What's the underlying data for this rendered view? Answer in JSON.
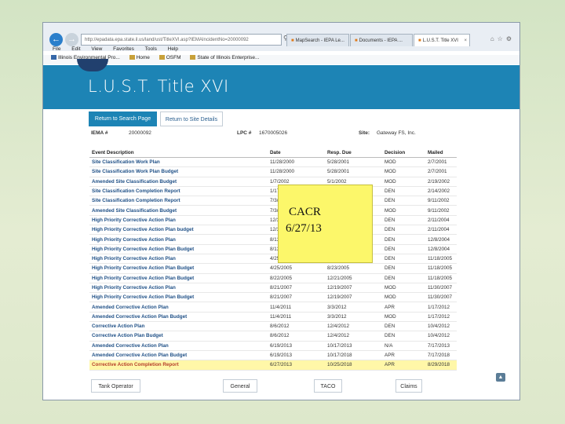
{
  "browser": {
    "url": "http://epadata.epa.state.il.us/land/ust/TitleXVI.asp?IEMAIncidentNo=20000092",
    "tabs": [
      {
        "label": "MapSearch - IEPA Le..."
      },
      {
        "label": "Documents - IEPA ..."
      },
      {
        "label": "L.U.S.T. Title XVI"
      }
    ],
    "menu": [
      "File",
      "Edit",
      "View",
      "Favorites",
      "Tools",
      "Help"
    ],
    "favorites": [
      "Illinois Environmental Pro...",
      "Home",
      "OSFM",
      "State of Illinois Enterprise..."
    ]
  },
  "page": {
    "title": "L.U.S.T. Title XVI",
    "buttons": {
      "return_search": "Return to Search Page",
      "return_site": "Return to Site Details"
    },
    "info": {
      "iema_label": "IEMA #",
      "iema_value": "20000092",
      "lpc_label": "LPC #",
      "lpc_value": "1670005026",
      "site_label": "Site:",
      "site_value": "Gateway FS, Inc."
    },
    "table": {
      "headers": [
        "Event Description",
        "Date",
        "Resp. Due",
        "Decision",
        "Mailed"
      ],
      "rows": [
        [
          "Site Classification Work Plan",
          "11/28/2000",
          "5/28/2001",
          "MOD",
          "2/7/2001"
        ],
        [
          "Site Classification Work Plan Budget",
          "11/28/2000",
          "5/28/2001",
          "MOD",
          "2/7/2001"
        ],
        [
          "Amended Site Classification Budget",
          "1/7/2002",
          "5/1/2002",
          "MOD",
          "2/19/2002"
        ],
        [
          "Site Classification Completion Report",
          "1/17/2002",
          "",
          "DEN",
          "2/14/2002"
        ],
        [
          "Site Classification Completion Report",
          "7/3/2002",
          "",
          "DEN",
          "9/11/2002"
        ],
        [
          "Amended Site Classification Budget",
          "7/3/2002",
          "",
          "MOD",
          "9/11/2002"
        ],
        [
          "High Priority Corrective Action Plan",
          "12/30/2003",
          "",
          "DEN",
          "2/11/2004"
        ],
        [
          "High Priority Corrective Action Plan budget",
          "12/30/2003",
          "",
          "DEN",
          "2/11/2004"
        ],
        [
          "High Priority Corrective Action Plan",
          "8/13/2004",
          "",
          "DEN",
          "12/8/2004"
        ],
        [
          "High Priority Corrective Action Plan Budget",
          "8/13/2004",
          "",
          "DEN",
          "12/8/2004"
        ],
        [
          "High Priority Corrective Action Plan",
          "4/25/2005",
          "",
          "DEN",
          "11/18/2005"
        ],
        [
          "High Priority Corrective Action Plan Budget",
          "4/25/2005",
          "8/23/2005",
          "DEN",
          "11/18/2005"
        ],
        [
          "High Priority Corrective Action Plan Budget",
          "8/22/2005",
          "12/21/2005",
          "DEN",
          "11/18/2005"
        ],
        [
          "High Priority Corrective Action Plan",
          "8/21/2007",
          "12/19/2007",
          "MOD",
          "11/30/2007"
        ],
        [
          "High Priority Corrective Action Plan Budget",
          "8/21/2007",
          "12/19/2007",
          "MOD",
          "11/30/2007"
        ],
        [
          "Amended Corrective Action Plan",
          "11/4/2011",
          "3/3/2012",
          "APR",
          "1/17/2012"
        ],
        [
          "Amended Corrective Action Plan Budget",
          "11/4/2011",
          "3/3/2012",
          "MOD",
          "1/17/2012"
        ],
        [
          "Corrective Action Plan",
          "8/6/2012",
          "12/4/2012",
          "DEN",
          "10/4/2012"
        ],
        [
          "Corrective Action Plan Budget",
          "8/6/2012",
          "12/4/2012",
          "DEN",
          "10/4/2012"
        ],
        [
          "Amended Corrective Action Plan",
          "6/19/2013",
          "10/17/2013",
          "N/A",
          "7/17/2013"
        ],
        [
          "Amended Corrective Action Plan Budget",
          "6/19/2013",
          "10/17/2018",
          "APR",
          "7/17/2018"
        ],
        [
          "Corrective Action Completion Report",
          "6/27/2013",
          "10/25/2018",
          "APR",
          "8/29/2018"
        ]
      ],
      "highlight_row": 21,
      "highlight_color": "#fff7a8"
    },
    "note": {
      "line1": "CACR",
      "line2": "6/27/13",
      "color": "#fcf76a"
    },
    "bottom_tabs": [
      "Tank Operator",
      "General",
      "TACO",
      "Claims"
    ],
    "colors": {
      "header_blue": "#1d84b5",
      "link_blue": "#1e4f86"
    }
  }
}
